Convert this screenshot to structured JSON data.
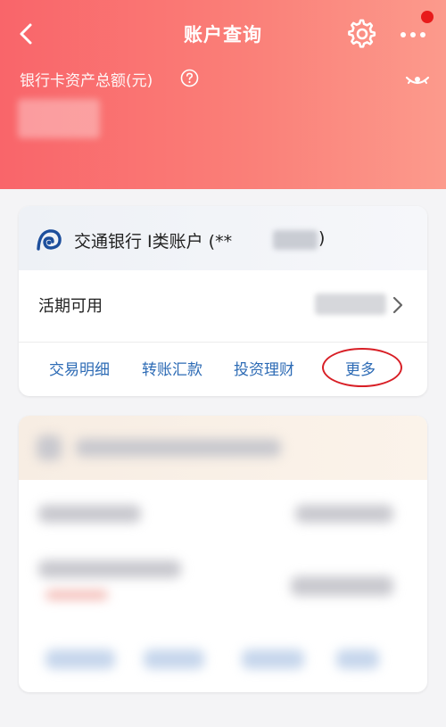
{
  "header": {
    "title": "账户查询",
    "asset_label": "银行卡资产总额(元)"
  },
  "account_card": {
    "bank_name": "交通银行 I类账户 (**",
    "bank_name_close": ")",
    "balance_label": "活期可用",
    "actions": [
      {
        "label": "交易明细"
      },
      {
        "label": "转账汇款"
      },
      {
        "label": "投资理财"
      },
      {
        "label": "更多"
      }
    ]
  },
  "colors": {
    "header_start": "#f9656a",
    "header_end": "#fc9a8c",
    "link": "#2d6bb5",
    "highlight_circle": "#d81f26",
    "notification_dot": "#e81a1a"
  }
}
